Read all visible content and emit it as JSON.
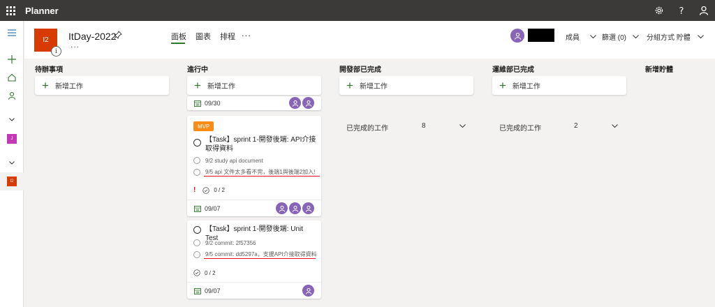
{
  "app": {
    "title": "Planner"
  },
  "topbar": {
    "icons": [
      "waffle-icon",
      "gear-icon",
      "help-icon",
      "person-icon"
    ]
  },
  "header": {
    "plan_initials": "I2",
    "plan_name": "ItDay-2022",
    "more": "...",
    "tabs": [
      {
        "label": "面板",
        "active": true
      },
      {
        "label": "圖表",
        "active": false
      },
      {
        "label": "排程",
        "active": false
      }
    ],
    "tabs_more": "...",
    "members_label": "成員",
    "filter_label": "篩選 (0)",
    "group_label": "分組方式 貯體"
  },
  "rail": {
    "plan_a_letter": "J",
    "plan_b_letter": "I2",
    "colors": {
      "plan_a": "#c239b3",
      "plan_b": "#d83b01"
    }
  },
  "columns": [
    {
      "title": "待辦事項",
      "add_label": "新增工作"
    },
    {
      "title": "進行中",
      "add_label": "新增工作"
    },
    {
      "title": "開發部已完成",
      "add_label": "新增工作",
      "completed_label": "已完成的工作",
      "completed_count": "8"
    },
    {
      "title": "運維部已完成",
      "add_label": "新增工作",
      "completed_label": "已完成的工作",
      "completed_count": "2"
    },
    {
      "title": "新增貯體"
    }
  ],
  "cards": [
    {
      "due": "09/30",
      "assignees": 2
    },
    {
      "label": "MVP",
      "title": "【Task】sprint 1-開發後端: API介接取得資料",
      "checklist": [
        "9/2 study api document",
        "9/5 api 文件太多看不完，後端1與後端2加入!"
      ],
      "priority": "!",
      "progress": "0 / 2",
      "due": "09/07",
      "assignees": 3
    },
    {
      "title": "【Task】sprint 1-開發後端: Unit Test",
      "checklist": [
        "9/2 commit: 2f57356",
        "9/5 commit: dd5297a，支援API介接取得資料"
      ],
      "progress": "0 / 2",
      "due": "09/07",
      "assignees": 1
    }
  ],
  "colors": {
    "accent": "#31752f",
    "topbar": "#3b3a39",
    "avatar": "#8764b8",
    "label_mvp": "#fa8c16",
    "highlight": "#e81123"
  }
}
